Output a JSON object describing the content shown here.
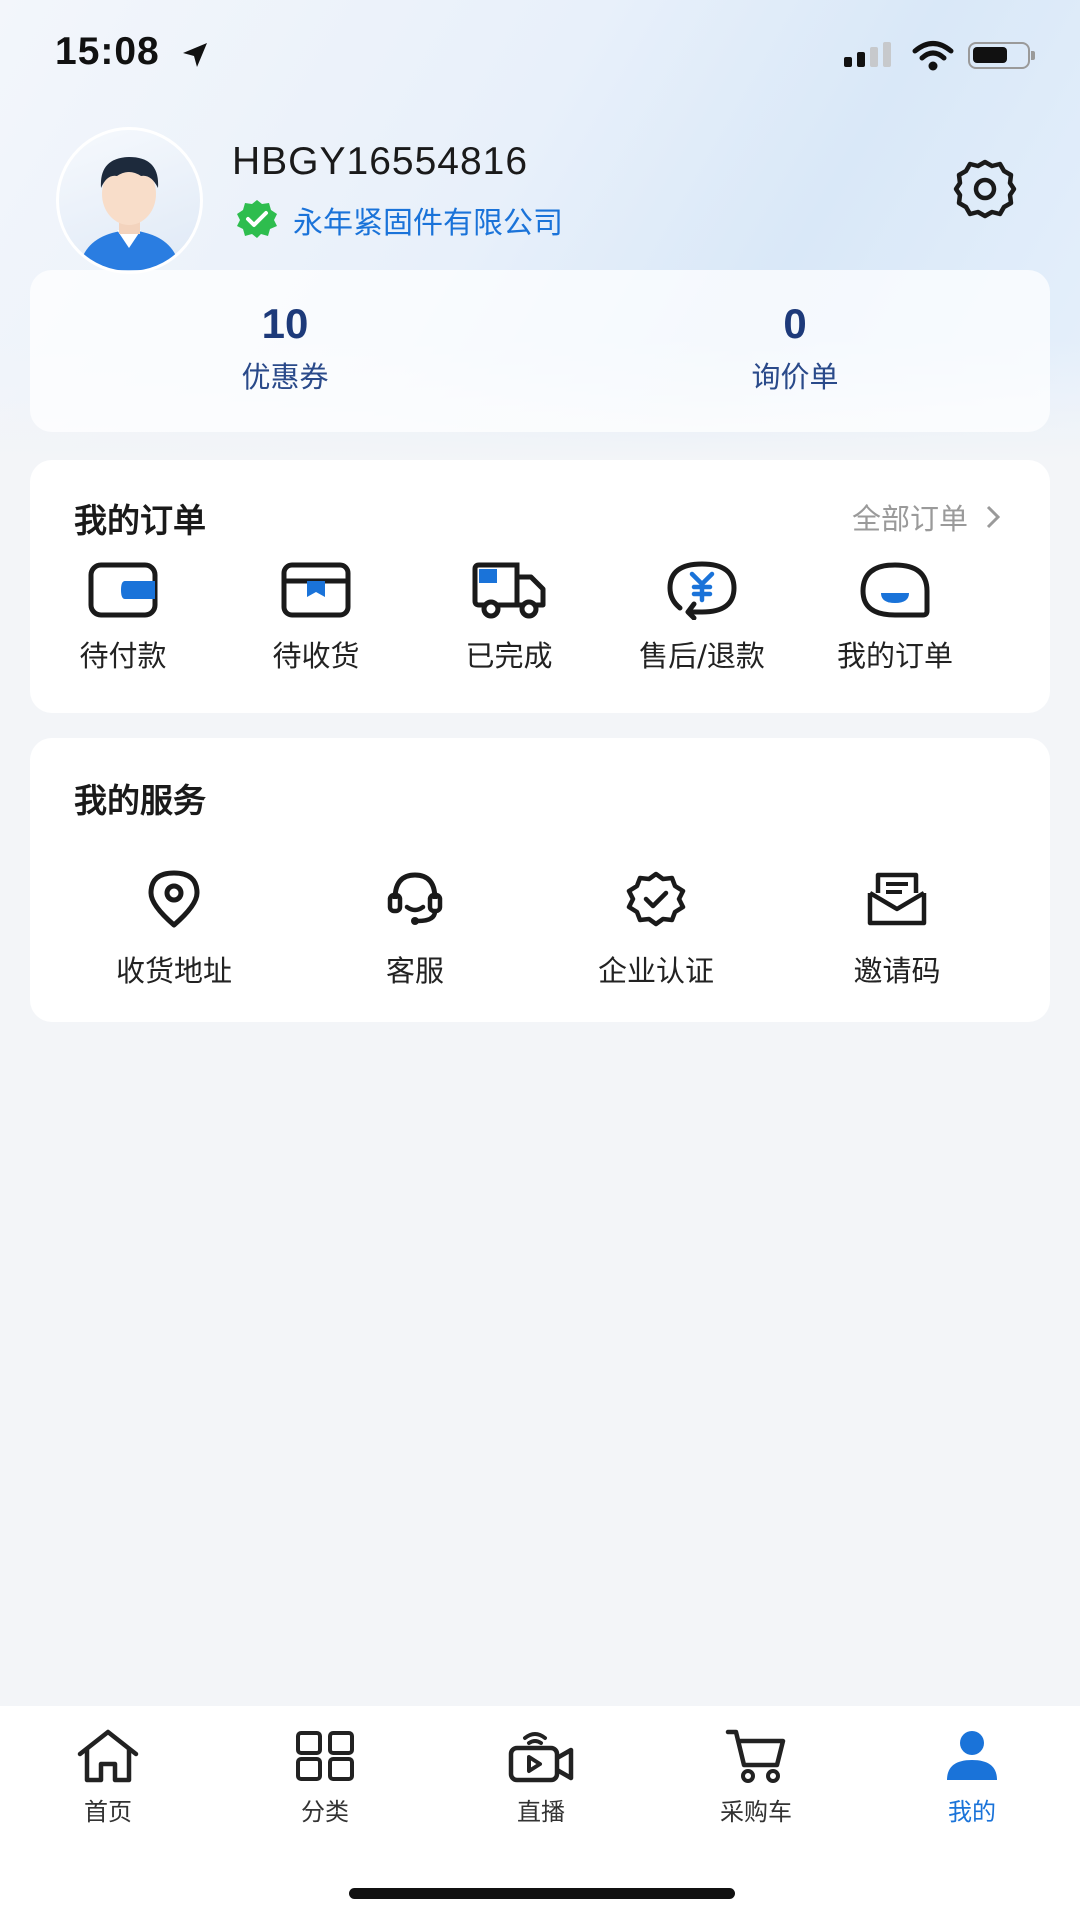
{
  "status_bar": {
    "time": "15:08"
  },
  "profile": {
    "username": "HBGY16554816",
    "company": "永年紧固件有限公司"
  },
  "stats": [
    {
      "value": "10",
      "label": "优惠券"
    },
    {
      "value": "0",
      "label": "询价单"
    }
  ],
  "orders": {
    "title": "我的订单",
    "all_label": "全部订单",
    "items": [
      {
        "label": "待付款",
        "icon": "wallet-icon"
      },
      {
        "label": "待收货",
        "icon": "box-icon"
      },
      {
        "label": "已完成",
        "icon": "truck-icon"
      },
      {
        "label": "售后/退款",
        "icon": "refund-icon"
      },
      {
        "label": "我的订单",
        "icon": "chat-order-icon"
      }
    ]
  },
  "services": {
    "title": "我的服务",
    "items": [
      {
        "label": "收货地址",
        "icon": "location-pin-icon"
      },
      {
        "label": "客服",
        "icon": "headset-icon"
      },
      {
        "label": "企业认证",
        "icon": "verified-badge-icon"
      },
      {
        "label": "邀请码",
        "icon": "envelope-icon"
      }
    ]
  },
  "tab_bar": {
    "active": "我的",
    "tabs": [
      {
        "label": "首页",
        "icon": "home-icon"
      },
      {
        "label": "分类",
        "icon": "grid-icon"
      },
      {
        "label": "直播",
        "icon": "live-camera-icon"
      },
      {
        "label": "采购车",
        "icon": "cart-icon"
      },
      {
        "label": "我的",
        "icon": "user-icon"
      }
    ]
  },
  "colors": {
    "accent": "#1a73d9",
    "dark_blue": "#1d3a7a",
    "verified_green": "#2ebd4e"
  }
}
